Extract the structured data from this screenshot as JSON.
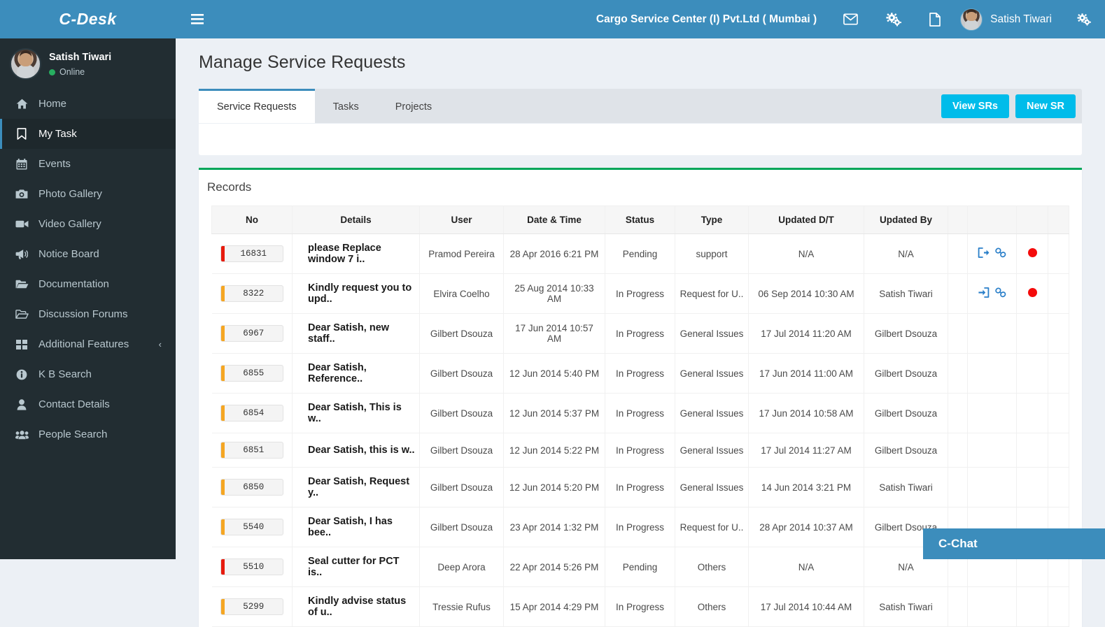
{
  "brand": {
    "name": "C-Desk"
  },
  "sidebar": {
    "user": {
      "name": "Satish Tiwari",
      "status": "Online",
      "status_color": "#27ae60"
    },
    "items": [
      {
        "label": "Home",
        "icon": "home-icon",
        "active": false
      },
      {
        "label": "My Task",
        "icon": "bookmark-icon",
        "active": true
      },
      {
        "label": "Events",
        "icon": "calendar-icon",
        "active": false
      },
      {
        "label": "Photo Gallery",
        "icon": "camera-icon",
        "active": false
      },
      {
        "label": "Video Gallery",
        "icon": "video-camera-icon",
        "active": false
      },
      {
        "label": "Notice Board",
        "icon": "bullhorn-icon",
        "active": false
      },
      {
        "label": "Documentation",
        "icon": "folder-open-icon",
        "active": false
      },
      {
        "label": "Discussion Forums",
        "icon": "folder-outline-icon",
        "active": false
      },
      {
        "label": "Additional Features",
        "icon": "th-large-icon",
        "active": false,
        "chevron": "‹"
      },
      {
        "label": "K B Search",
        "icon": "info-circle-icon",
        "active": false
      },
      {
        "label": "Contact Details",
        "icon": "user-icon",
        "active": false
      },
      {
        "label": "People Search",
        "icon": "users-icon",
        "active": false
      }
    ]
  },
  "topbar": {
    "company": "Cargo Service Center (I) Pvt.Ltd ( Mumbai )",
    "user_name": "Satish Tiwari",
    "icons": [
      "menu-icon",
      "envelope-icon",
      "cogs-icon",
      "file-icon",
      "cogs-icon"
    ],
    "accent": "#3c8dbc"
  },
  "page": {
    "title": "Manage Service Requests"
  },
  "tabs": [
    {
      "label": "Service Requests",
      "active": true
    },
    {
      "label": "Tasks",
      "active": false
    },
    {
      "label": "Projects",
      "active": false
    }
  ],
  "actions": {
    "view_srs": "View SRs",
    "new_sr": "New SR",
    "button_color": "#00bcea"
  },
  "records": {
    "title": "Records",
    "accent": "#00a65a",
    "columns": [
      "No",
      "Details",
      "User",
      "Date & Time",
      "Status",
      "Type",
      "Updated D/T",
      "Updated By",
      "",
      "",
      "",
      ""
    ],
    "rows": [
      {
        "no": "16831",
        "priority_color": "#e71b0d",
        "details": "please Replace window 7 i..",
        "user": "Pramod Pereira",
        "datetime": "28 Apr 2016 6:21 PM",
        "status": "Pending",
        "type": "support",
        "updated_dt": "N/A",
        "updated_by": "N/A",
        "icons": [
          "sign-out-icon",
          "link-icon"
        ],
        "flag": true
      },
      {
        "no": "8322",
        "priority_color": "#f5a623",
        "details": "Kindly request you to upd..",
        "user": "Elvira Coelho",
        "datetime": "25 Aug 2014 10:33 AM",
        "status": "In Progress",
        "type": "Request for U..",
        "updated_dt": "06 Sep 2014 10:30 AM",
        "updated_by": "Satish Tiwari",
        "icons": [
          "sign-in-icon",
          "link-icon"
        ],
        "flag": true
      },
      {
        "no": "6967",
        "priority_color": "#f5a623",
        "details": "Dear Satish, new staff..",
        "user": "Gilbert Dsouza",
        "datetime": "17 Jun 2014 10:57 AM",
        "status": "In Progress",
        "type": "General Issues",
        "updated_dt": "17 Jul 2014 11:20 AM",
        "updated_by": "Gilbert Dsouza",
        "icons": [],
        "flag": false
      },
      {
        "no": "6855",
        "priority_color": "#f5a623",
        "details": "Dear Satish, Reference..",
        "user": "Gilbert Dsouza",
        "datetime": "12 Jun 2014 5:40 PM",
        "status": "In Progress",
        "type": "General Issues",
        "updated_dt": "17 Jun 2014 11:00 AM",
        "updated_by": "Gilbert Dsouza",
        "icons": [],
        "flag": false
      },
      {
        "no": "6854",
        "priority_color": "#f5a623",
        "details": "Dear Satish, This is w..",
        "user": "Gilbert Dsouza",
        "datetime": "12 Jun 2014 5:37 PM",
        "status": "In Progress",
        "type": "General Issues",
        "updated_dt": "17 Jun 2014 10:58 AM",
        "updated_by": "Gilbert Dsouza",
        "icons": [],
        "flag": false
      },
      {
        "no": "6851",
        "priority_color": "#f5a623",
        "details": "Dear Satish, this is w..",
        "user": "Gilbert Dsouza",
        "datetime": "12 Jun 2014 5:22 PM",
        "status": "In Progress",
        "type": "General Issues",
        "updated_dt": "17 Jul 2014 11:27 AM",
        "updated_by": "Gilbert Dsouza",
        "icons": [],
        "flag": false
      },
      {
        "no": "6850",
        "priority_color": "#f5a623",
        "details": "Dear Satish, Request y..",
        "user": "Gilbert Dsouza",
        "datetime": "12 Jun 2014 5:20 PM",
        "status": "In Progress",
        "type": "General Issues",
        "updated_dt": "14 Jun 2014 3:21 PM",
        "updated_by": "Satish Tiwari",
        "icons": [],
        "flag": false
      },
      {
        "no": "5540",
        "priority_color": "#f5a623",
        "details": "Dear Satish, I has bee..",
        "user": "Gilbert Dsouza",
        "datetime": "23 Apr 2014 1:32 PM",
        "status": "In Progress",
        "type": "Request for U..",
        "updated_dt": "28 Apr 2014 10:37 AM",
        "updated_by": "Gilbert Dsouza",
        "icons": [],
        "flag": false
      },
      {
        "no": "5510",
        "priority_color": "#e71b0d",
        "details": "Seal cutter for PCT is..",
        "user": "Deep Arora",
        "datetime": "22 Apr 2014 5:26 PM",
        "status": "Pending",
        "type": "Others",
        "updated_dt": "N/A",
        "updated_by": "N/A",
        "icons": [],
        "flag": false
      },
      {
        "no": "5299",
        "priority_color": "#f5a623",
        "details": "Kindly advise status of u..",
        "user": "Tressie Rufus",
        "datetime": "15 Apr 2014 4:29 PM",
        "status": "In Progress",
        "type": "Others",
        "updated_dt": "17 Jul 2014 10:44 AM",
        "updated_by": "Satish Tiwari",
        "icons": [],
        "flag": false
      }
    ]
  },
  "chat": {
    "label": "C-Chat"
  }
}
